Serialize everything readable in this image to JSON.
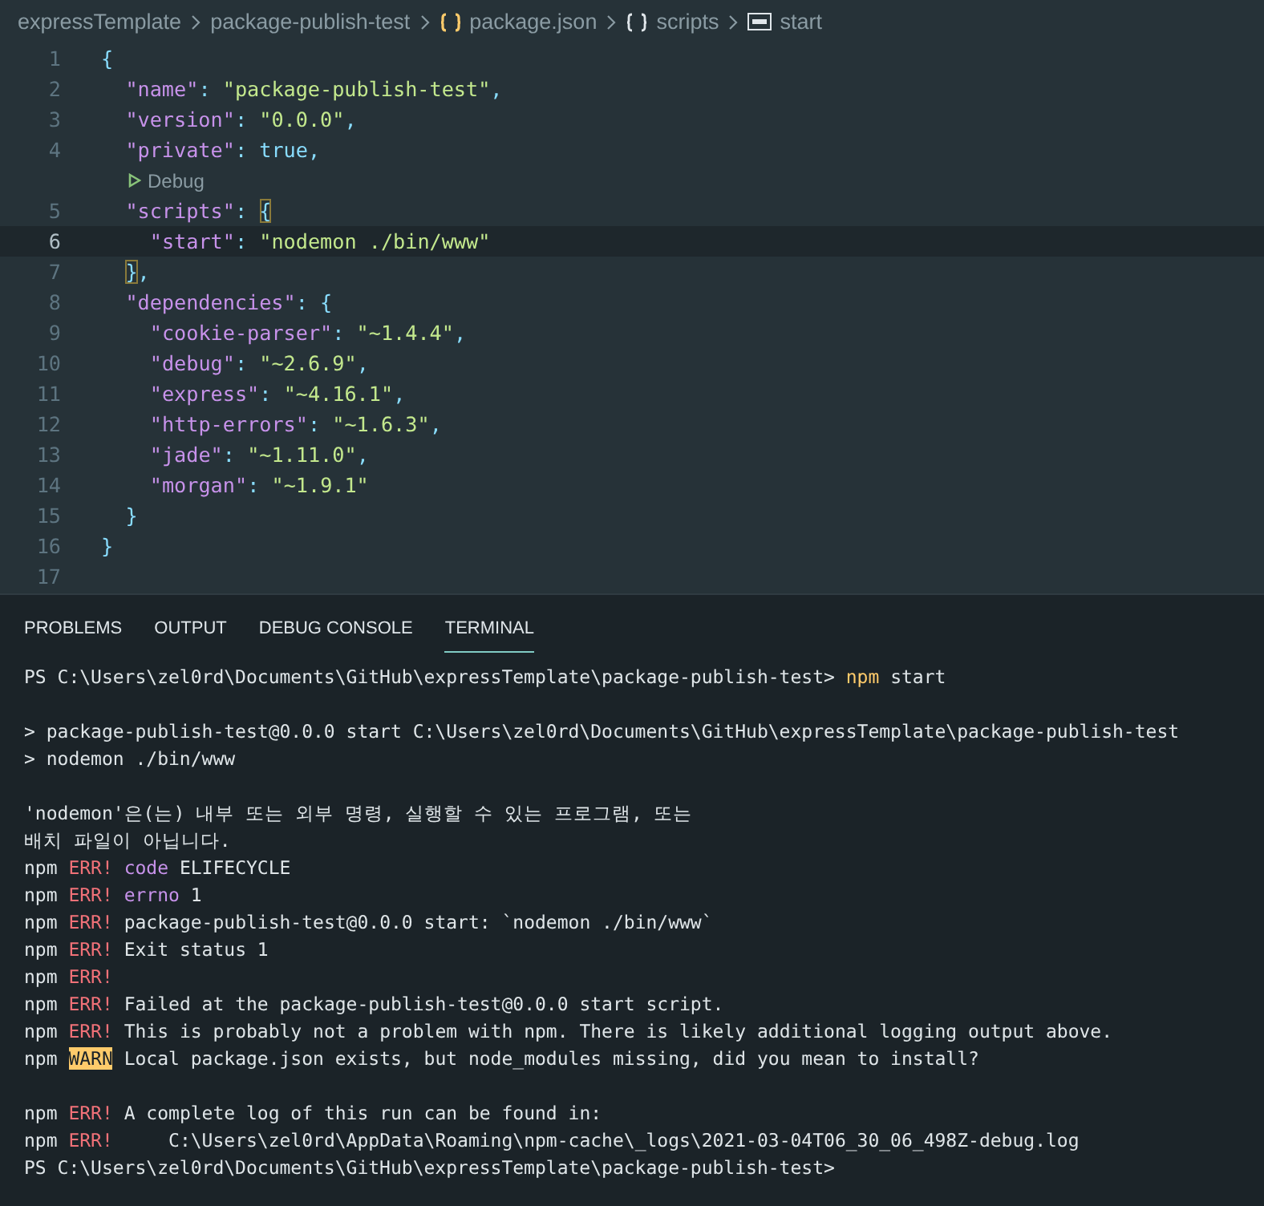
{
  "breadcrumbs": [
    {
      "text": "expressTemplate",
      "kind": "folder"
    },
    {
      "text": "package-publish-test",
      "kind": "folder"
    },
    {
      "text": "package.json",
      "kind": "json"
    },
    {
      "text": "scripts",
      "kind": "object"
    },
    {
      "text": "start",
      "kind": "string"
    }
  ],
  "editor": {
    "lines": [
      {
        "kind": "code",
        "number": "1",
        "current": false,
        "tokens": [
          {
            "kind": "open",
            "text": "{"
          }
        ]
      },
      {
        "kind": "code",
        "number": "2",
        "current": false,
        "tokens": [
          {
            "kind": "key",
            "text": "\"name\""
          },
          {
            "kind": "punct",
            "text": ": "
          },
          {
            "kind": "string",
            "text": "\"package-publish-test\""
          },
          {
            "kind": "punct",
            "text": ","
          }
        ]
      },
      {
        "kind": "code",
        "number": "3",
        "current": false,
        "tokens": [
          {
            "kind": "key",
            "text": "\"version\""
          },
          {
            "kind": "punct",
            "text": ": "
          },
          {
            "kind": "string",
            "text": "\"0.0.0\""
          },
          {
            "kind": "punct",
            "text": ","
          }
        ]
      },
      {
        "kind": "code",
        "number": "4",
        "current": false,
        "tokens": [
          {
            "kind": "key",
            "text": "\"private\""
          },
          {
            "kind": "punct",
            "text": ": "
          },
          {
            "kind": "bool",
            "text": "true"
          },
          {
            "kind": "punct",
            "text": ","
          }
        ]
      },
      {
        "kind": "lens",
        "text": "Debug"
      },
      {
        "kind": "code",
        "number": "5",
        "current": false,
        "tokens": [
          {
            "kind": "key",
            "text": "\"scripts\""
          },
          {
            "kind": "punct",
            "text": ": "
          },
          {
            "kind": "open-match",
            "text": "{"
          }
        ]
      },
      {
        "kind": "code",
        "number": "6",
        "current": true,
        "tokens": [
          {
            "kind": "key",
            "text": "\"start\""
          },
          {
            "kind": "punct",
            "text": ": "
          },
          {
            "kind": "string",
            "text": "\"nodemon ./bin/www\""
          }
        ]
      },
      {
        "kind": "code",
        "number": "7",
        "current": false,
        "tokens": [
          {
            "kind": "close-match",
            "text": "}"
          },
          {
            "kind": "punct",
            "text": ","
          }
        ]
      },
      {
        "kind": "code",
        "number": "8",
        "current": false,
        "tokens": [
          {
            "kind": "key",
            "text": "\"dependencies\""
          },
          {
            "kind": "punct",
            "text": ": "
          },
          {
            "kind": "open",
            "text": "{"
          }
        ]
      },
      {
        "kind": "code",
        "number": "9",
        "current": false,
        "tokens": [
          {
            "kind": "key",
            "text": "\"cookie-parser\""
          },
          {
            "kind": "punct",
            "text": ": "
          },
          {
            "kind": "string",
            "text": "\"~1.4.4\""
          },
          {
            "kind": "punct",
            "text": ","
          }
        ]
      },
      {
        "kind": "code",
        "number": "10",
        "current": false,
        "tokens": [
          {
            "kind": "key",
            "text": "\"debug\""
          },
          {
            "kind": "punct",
            "text": ": "
          },
          {
            "kind": "string",
            "text": "\"~2.6.9\""
          },
          {
            "kind": "punct",
            "text": ","
          }
        ]
      },
      {
        "kind": "code",
        "number": "11",
        "current": false,
        "tokens": [
          {
            "kind": "key",
            "text": "\"express\""
          },
          {
            "kind": "punct",
            "text": ": "
          },
          {
            "kind": "string",
            "text": "\"~4.16.1\""
          },
          {
            "kind": "punct",
            "text": ","
          }
        ]
      },
      {
        "kind": "code",
        "number": "12",
        "current": false,
        "tokens": [
          {
            "kind": "key",
            "text": "\"http-errors\""
          },
          {
            "kind": "punct",
            "text": ": "
          },
          {
            "kind": "string",
            "text": "\"~1.6.3\""
          },
          {
            "kind": "punct",
            "text": ","
          }
        ]
      },
      {
        "kind": "code",
        "number": "13",
        "current": false,
        "tokens": [
          {
            "kind": "key",
            "text": "\"jade\""
          },
          {
            "kind": "punct",
            "text": ": "
          },
          {
            "kind": "string",
            "text": "\"~1.11.0\""
          },
          {
            "kind": "punct",
            "text": ","
          }
        ]
      },
      {
        "kind": "code",
        "number": "14",
        "current": false,
        "tokens": [
          {
            "kind": "key",
            "text": "\"morgan\""
          },
          {
            "kind": "punct",
            "text": ": "
          },
          {
            "kind": "string",
            "text": "\"~1.9.1\""
          }
        ]
      },
      {
        "kind": "code",
        "number": "15",
        "current": false,
        "tokens": [
          {
            "kind": "close",
            "text": "}"
          }
        ]
      },
      {
        "kind": "code",
        "number": "16",
        "current": false,
        "tokens": [
          {
            "kind": "close",
            "text": "}"
          }
        ]
      },
      {
        "kind": "code",
        "number": "17",
        "current": false
      }
    ]
  },
  "panel": {
    "tabs": [
      {
        "label": "PROBLEMS",
        "selected": false
      },
      {
        "label": "OUTPUT",
        "selected": false
      },
      {
        "label": "DEBUG CONSOLE",
        "selected": false
      },
      {
        "label": "TERMINAL",
        "selected": true
      }
    ],
    "terminal": [
      {
        "kind": "text",
        "segments": [
          {
            "kind": "plain",
            "text": "PS C:\\Users\\zel0rd\\Documents\\GitHub\\expressTemplate\\package-publish-test> "
          },
          {
            "kind": "cmd",
            "text": "npm"
          },
          {
            "kind": "plain",
            "text": " start"
          }
        ]
      },
      {
        "kind": "blank"
      },
      {
        "kind": "text",
        "segments": [
          {
            "kind": "plain",
            "text": "> package-publish-test@0.0.0 start C:\\Users\\zel0rd\\Documents\\GitHub\\expressTemplate\\package-publish-test"
          }
        ]
      },
      {
        "kind": "text",
        "segments": [
          {
            "kind": "plain",
            "text": "> nodemon ./bin/www"
          }
        ]
      },
      {
        "kind": "blank"
      },
      {
        "kind": "text",
        "segments": [
          {
            "kind": "plain",
            "text": "'nodemon'은(는) 내부 또는 외부 명령, 실행할 수 있는 프로그램, 또는"
          }
        ]
      },
      {
        "kind": "text",
        "segments": [
          {
            "kind": "plain",
            "text": "배치 파일이 아닙니다."
          }
        ]
      },
      {
        "kind": "text",
        "segments": [
          {
            "kind": "plain",
            "text": "npm "
          },
          {
            "kind": "err",
            "text": "ERR!"
          },
          {
            "kind": "key",
            "text": " code"
          },
          {
            "kind": "plain",
            "text": " ELIFECYCLE"
          }
        ]
      },
      {
        "kind": "text",
        "segments": [
          {
            "kind": "plain",
            "text": "npm "
          },
          {
            "kind": "err",
            "text": "ERR!"
          },
          {
            "kind": "key",
            "text": " errno"
          },
          {
            "kind": "plain",
            "text": " 1"
          }
        ]
      },
      {
        "kind": "text",
        "segments": [
          {
            "kind": "plain",
            "text": "npm "
          },
          {
            "kind": "err",
            "text": "ERR!"
          },
          {
            "kind": "plain",
            "text": " package-publish-test@0.0.0 start: `nodemon ./bin/www`"
          }
        ]
      },
      {
        "kind": "text",
        "segments": [
          {
            "kind": "plain",
            "text": "npm "
          },
          {
            "kind": "err",
            "text": "ERR!"
          },
          {
            "kind": "plain",
            "text": " Exit status 1"
          }
        ]
      },
      {
        "kind": "text",
        "segments": [
          {
            "kind": "plain",
            "text": "npm "
          },
          {
            "kind": "err",
            "text": "ERR!"
          }
        ]
      },
      {
        "kind": "text",
        "segments": [
          {
            "kind": "plain",
            "text": "npm "
          },
          {
            "kind": "err",
            "text": "ERR!"
          },
          {
            "kind": "plain",
            "text": " Failed at the package-publish-test@0.0.0 start script."
          }
        ]
      },
      {
        "kind": "text",
        "segments": [
          {
            "kind": "plain",
            "text": "npm "
          },
          {
            "kind": "err",
            "text": "ERR!"
          },
          {
            "kind": "plain",
            "text": " This is probably not a problem with npm. There is likely additional logging output above."
          }
        ]
      },
      {
        "kind": "text",
        "segments": [
          {
            "kind": "plain",
            "text": "npm "
          },
          {
            "kind": "warn",
            "text": "WARN"
          },
          {
            "kind": "plain",
            "text": " Local package.json exists, but node_modules missing, did you mean to install?"
          }
        ]
      },
      {
        "kind": "blank"
      },
      {
        "kind": "text",
        "segments": [
          {
            "kind": "plain",
            "text": "npm "
          },
          {
            "kind": "err",
            "text": "ERR!"
          },
          {
            "kind": "plain",
            "text": " A complete log of this run can be found in:"
          }
        ]
      },
      {
        "kind": "text",
        "segments": [
          {
            "kind": "plain",
            "text": "npm "
          },
          {
            "kind": "err",
            "text": "ERR!"
          },
          {
            "kind": "plain",
            "text": "     C:\\Users\\zel0rd\\AppData\\Roaming\\npm-cache\\_logs\\2021-03-04T06_30_06_498Z-debug.log"
          }
        ]
      },
      {
        "kind": "text",
        "segments": [
          {
            "kind": "plain",
            "text": "PS C:\\Users\\zel0rd\\Documents\\GitHub\\expressTemplate\\package-publish-test>"
          }
        ]
      }
    ]
  }
}
